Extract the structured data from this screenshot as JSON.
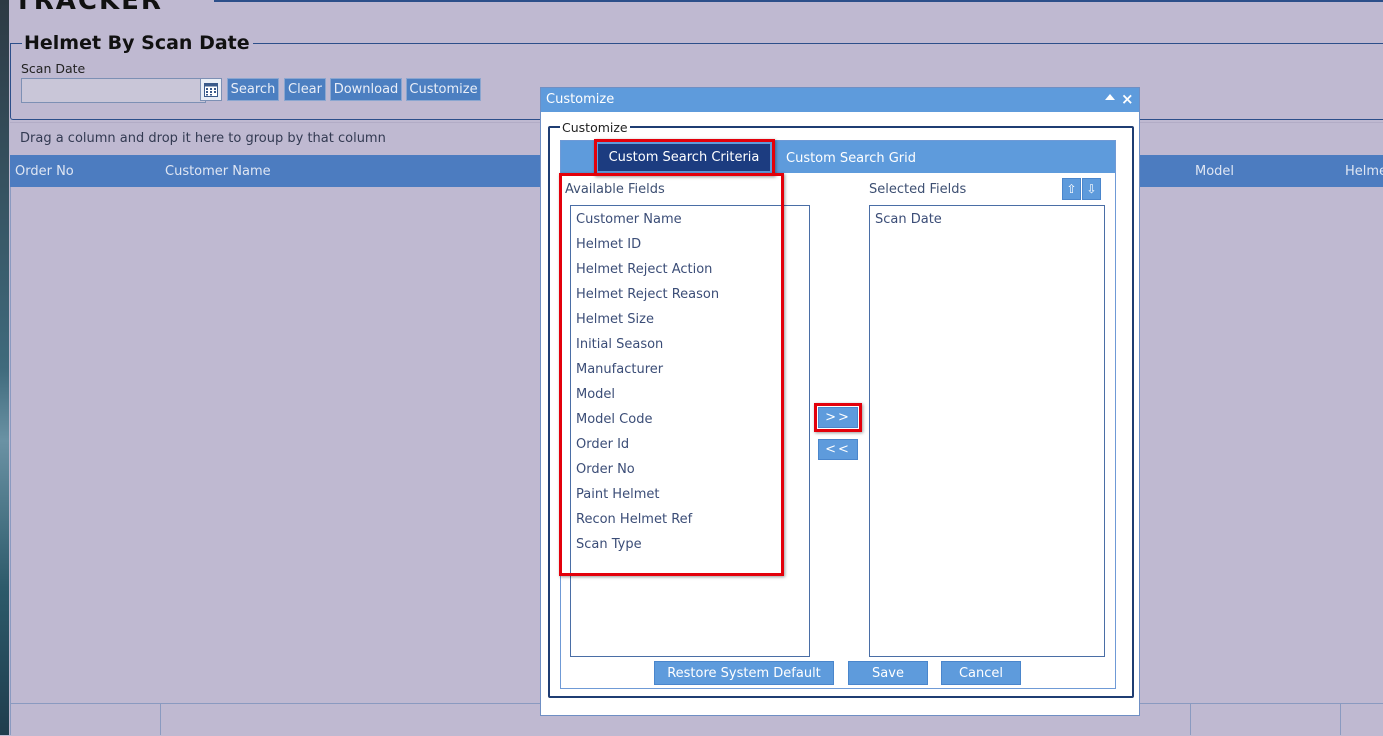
{
  "header": {
    "logo_text": "TRACKER"
  },
  "page": {
    "title": "Helmet By Scan Date",
    "scan_date_label": "Scan Date",
    "scan_date_value": "",
    "buttons": {
      "search": "Search",
      "clear": "Clear",
      "download": "Download",
      "customize": "Customize"
    }
  },
  "grid": {
    "group_hint": "Drag a column and drop it here to group by that column",
    "columns": [
      "Order No",
      "Customer Name",
      "Model",
      "Helme"
    ]
  },
  "dialog": {
    "title": "Customize",
    "fieldset_legend": "Customize",
    "tabs": {
      "criteria": "Custom Search Criteria",
      "grid": "Custom Search Grid"
    },
    "active_tab": "Custom Search Criteria",
    "available_label": "Available Fields",
    "selected_label": "Selected Fields",
    "available_fields": [
      "Customer Name",
      "Helmet ID",
      "Helmet Reject Action",
      "Helmet Reject Reason",
      "Helmet Size",
      "Initial Season",
      "Manufacturer",
      "Model",
      "Model Code",
      "Order Id",
      "Order No",
      "Paint Helmet",
      "Recon Helmet Ref",
      "Scan Type"
    ],
    "selected_fields": [
      "Scan Date"
    ],
    "move_right": ">>",
    "move_left": "<<",
    "move_up": "⇧",
    "move_down": "⇩",
    "restore": "Restore System Default",
    "save": "Save",
    "cancel": "Cancel"
  },
  "colors": {
    "accent": "#5e9bdc",
    "active_tab": "#1c3c80",
    "highlight": "#e3000b",
    "background": "#bfb9d1"
  }
}
